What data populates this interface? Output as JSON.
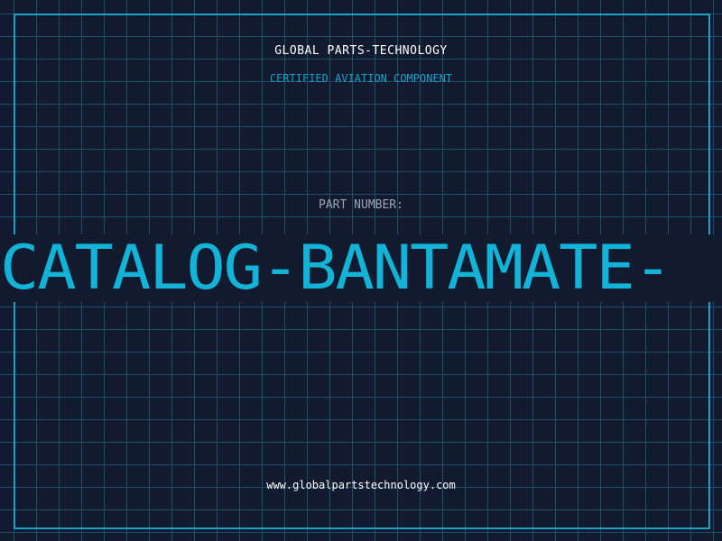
{
  "company": "GLOBAL PARTS-TECHNOLOGY",
  "subtitle": "CERTIFIED AVIATION COMPONENT",
  "part_number_label": "PART NUMBER:",
  "part_number_value": "CATALOG-BANTAMATE-",
  "url": "www.globalpartstechnology.com",
  "colors": {
    "background": "#111a2e",
    "grid": "#1e4f66",
    "accent": "#1aa3c7",
    "part_number": "#12b3d6",
    "label": "#9aa6b8",
    "text": "#ffffff"
  }
}
